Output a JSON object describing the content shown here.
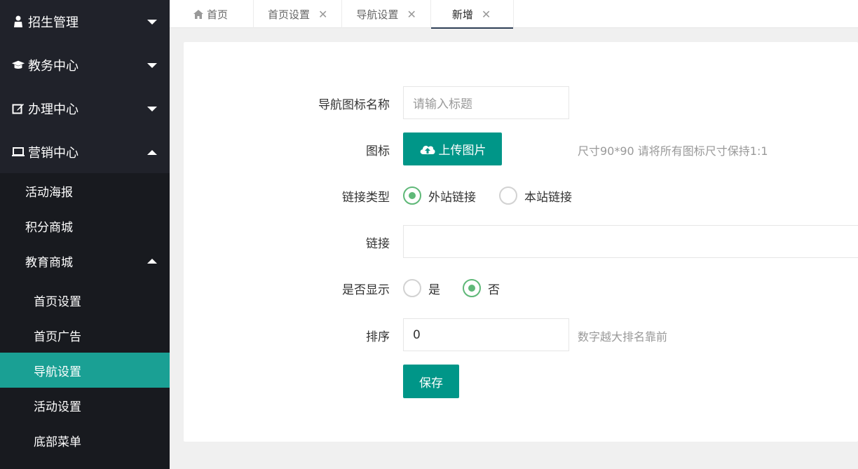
{
  "sidebar": {
    "menus": [
      {
        "label": "招生管理",
        "icon": "user-icon",
        "expanded": false
      },
      {
        "label": "教务中心",
        "icon": "graduation-cap-icon",
        "expanded": false
      },
      {
        "label": "办理中心",
        "icon": "edit-icon",
        "expanded": false
      },
      {
        "label": "营销中心",
        "icon": "laptop-icon",
        "expanded": true
      }
    ],
    "sub_items": [
      "活动海报",
      "积分商城",
      "教育商城"
    ],
    "sub2_items": [
      "首页设置",
      "首页广告",
      "导航设置",
      "活动设置",
      "底部菜单"
    ],
    "active": "导航设置"
  },
  "tabs": [
    {
      "label": "首页",
      "icon": "home-icon",
      "closable": false
    },
    {
      "label": "首页设置",
      "closable": true
    },
    {
      "label": "导航设置",
      "closable": true
    },
    {
      "label": "新增",
      "closable": true,
      "active": true
    }
  ],
  "tab_close_glyph": "✕",
  "form": {
    "nav_icon_name": {
      "label": "导航图标名称",
      "placeholder": "请输入标题",
      "value": ""
    },
    "icon": {
      "label": "图标",
      "button": "上传图片",
      "hint": "尺寸90*90 请将所有图标尺寸保持1:1"
    },
    "link_type": {
      "label": "链接类型",
      "options": [
        "外站链接",
        "本站链接"
      ],
      "selected": "外站链接"
    },
    "link": {
      "label": "链接",
      "value": ""
    },
    "show": {
      "label": "是否显示",
      "options": [
        "是",
        "否"
      ],
      "selected": "否"
    },
    "sort": {
      "label": "排序",
      "value": "0",
      "hint": "数字越大排名靠前"
    },
    "save_button": "保存"
  },
  "colors": {
    "sidebar_bg": "#20222a",
    "submenu_bg": "#181a1f",
    "active_item": "#1aa094",
    "primary": "#009688",
    "radio_checked": "#5fb878"
  }
}
